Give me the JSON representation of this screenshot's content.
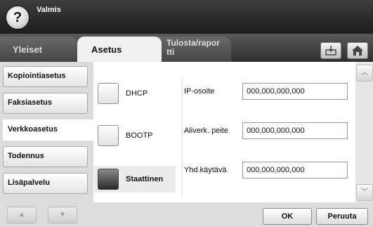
{
  "status": {
    "help_icon": "question-mark",
    "text": "Valmis"
  },
  "tabs": [
    {
      "label": "Yleiset"
    },
    {
      "label": "Asetus"
    },
    {
      "label": "Tulosta/rapor tti",
      "line1": "Tulosta/rapor",
      "line2": "tti"
    }
  ],
  "header_icons": [
    "tray-icon",
    "home-icon"
  ],
  "sidebar": {
    "items": [
      {
        "label": "Kopiointiasetus"
      },
      {
        "label": "Faksiasetus"
      },
      {
        "label": "Verkkoasetus",
        "selected": true
      },
      {
        "label": "Todennus"
      },
      {
        "label": "Lisäpalvelu"
      }
    ]
  },
  "ip_mode": {
    "options": [
      {
        "label": "DHCP",
        "selected": false
      },
      {
        "label": "BOOTP",
        "selected": false
      },
      {
        "label": "Staattinen",
        "selected": true
      }
    ]
  },
  "fields": [
    {
      "label": "IP-osoite",
      "value": "000,000,000,000"
    },
    {
      "label": "Aliverk. peite",
      "value": "000,000,000,000"
    },
    {
      "label": "Yhd.käytävä",
      "value": "000,000,000,000"
    }
  ],
  "actions": {
    "ok": "OK",
    "cancel": "Peruuta"
  }
}
